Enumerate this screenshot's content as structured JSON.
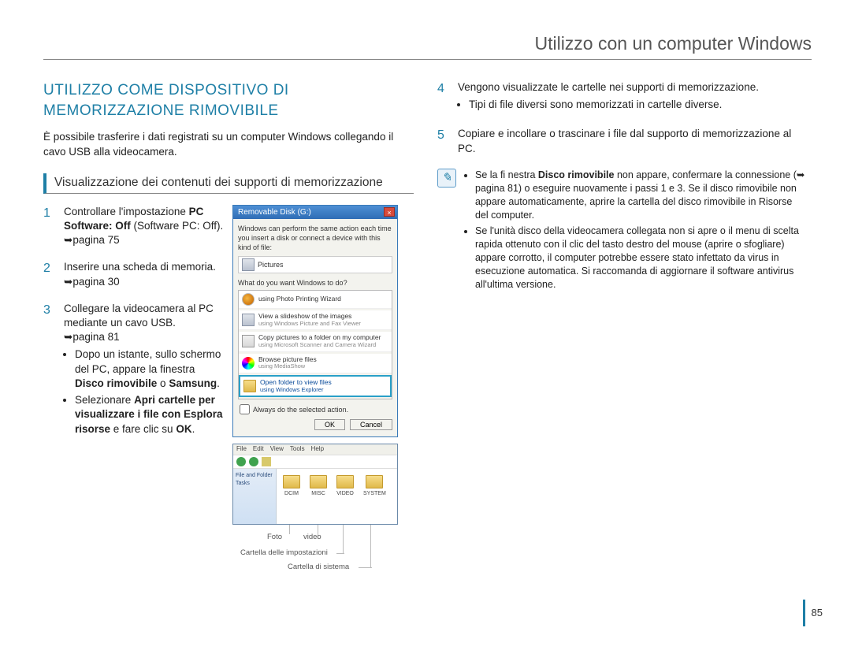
{
  "header": {
    "title": "Utilizzo con un computer Windows"
  },
  "section": {
    "title": "UTILIZZO COME DISPOSITIVO DI MEMORIZZAZIONE RIMOVIBILE",
    "intro": "È possibile trasferire i dati registrati su un computer Windows collegando il cavo USB alla videocamera.",
    "subhead": "Visualizzazione dei contenuti dei supporti di memorizzazione"
  },
  "steps": {
    "s1": {
      "num": "1",
      "pre": "Controllare l'impostazione ",
      "bold": "PC Software: Off",
      "post": " (Software PC: Off). ",
      "arrow": "➥",
      "ref": "pagina 75"
    },
    "s2": {
      "num": "2",
      "text": "Inserire una scheda di memoria. ",
      "arrow": "➥",
      "ref": "pagina 30"
    },
    "s3": {
      "num": "3",
      "line1": "Collegare la videocamera al PC mediante un cavo USB.",
      "arrow": "➥",
      "ref": "pagina 81",
      "b1_pre": "Dopo un istante, sullo schermo del PC, appare la finestra ",
      "b1_bold1": "Disco rimovibile",
      "b1_mid": " o ",
      "b1_bold2": "Samsung",
      "b1_post": ".",
      "b2_pre": "Selezionare ",
      "b2_bold1": "Apri cartelle per visualizzare i file con Esplora risorse",
      "b2_mid": " e fare clic su ",
      "b2_bold2": "OK",
      "b2_post": "."
    },
    "s4": {
      "num": "4",
      "text": "Vengono visualizzate le cartelle nei supporti di memorizzazione.",
      "bullet": "Tipi di file diversi sono memorizzati in cartelle diverse."
    },
    "s5": {
      "num": "5",
      "text": "Copiare e incollare o trascinare i file dal supporto di memorizzazione al PC."
    }
  },
  "dialog": {
    "title": "Removable Disk (G:)",
    "intro": "Windows can perform the same action each time you insert a disk or connect a device with this kind of file:",
    "pictures": "Pictures",
    "question": "What do you want Windows to do?",
    "rows": {
      "r1": {
        "title": "using Photo Printing Wizard"
      },
      "r2": {
        "title": "View a slideshow of the images",
        "sub": "using Windows Picture and Fax Viewer"
      },
      "r3": {
        "title": "Copy pictures to a folder on my computer",
        "sub": "using Microsoft Scanner and Camera Wizard"
      },
      "r4": {
        "title": "Browse picture files",
        "sub": "using MediaShow"
      },
      "r5": {
        "title": "Open folder to view files",
        "sub": "using Windows Explorer"
      }
    },
    "checkbox": "Always do the selected action.",
    "ok": "OK",
    "cancel": "Cancel"
  },
  "explorer": {
    "menu": [
      "File",
      "Edit",
      "View",
      "Tools",
      "Help"
    ],
    "side_title": "File and Folder Tasks",
    "folders": [
      "DCIM",
      "MISC",
      "VIDEO",
      "SYSTEM"
    ]
  },
  "callouts": {
    "foto": "Foto",
    "video": "video",
    "settings": "Cartella delle impostazioni",
    "system": "Cartella di sistema"
  },
  "note": {
    "n1_pre": "Se la fi nestra ",
    "n1_bold": "Disco rimovibile",
    "n1_mid": " non appare, confermare la connessione (",
    "n1_arrow": "➥",
    "n1_ref": "pagina 81",
    "n1_post": ") o eseguire nuovamente i passi 1 e 3. Se il disco rimovibile non appare automaticamente, aprire la cartella del disco rimovibile in Risorse del computer.",
    "n2": "Se l'unità disco della videocamera collegata non si apre o il menu di scelta rapida ottenuto con il clic del tasto destro del mouse (aprire o sfogliare) appare corrotto, il computer potrebbe essere stato infettato da virus in esecuzione automatica. Si raccomanda di aggiornare il software antivirus all'ultima versione."
  },
  "page_number": "85"
}
